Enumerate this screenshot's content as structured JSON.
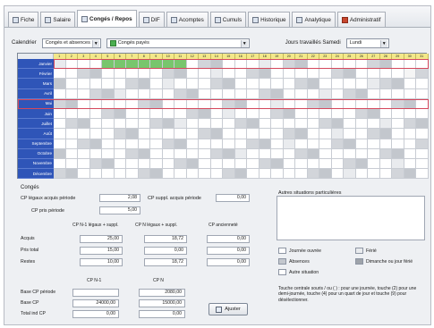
{
  "tabs": [
    {
      "label": "Fiche",
      "icon": "id-card-icon",
      "active": false
    },
    {
      "label": "Salaire",
      "icon": "wallet-icon",
      "active": false
    },
    {
      "label": "Congés / Repos",
      "icon": "calendar-icon",
      "active": true
    },
    {
      "label": "DIF",
      "icon": "graduation-icon",
      "active": false
    },
    {
      "label": "Acomptes",
      "icon": "money-icon",
      "active": false
    },
    {
      "label": "Cumuls",
      "icon": "sum-icon",
      "active": false
    },
    {
      "label": "Historique",
      "icon": "history-icon",
      "active": false
    },
    {
      "label": "Analytique",
      "icon": "chart-icon",
      "active": false
    },
    {
      "label": "Administratif",
      "icon": "folder-icon",
      "active": false
    }
  ],
  "filter": {
    "calendar_label": "Calendrier",
    "calendar_value": "Congés et absences",
    "type_value": "Congés payés",
    "hours_label": "Jours travaillés Samedi",
    "hours_value": "Lundi"
  },
  "calendar": {
    "days": [
      "1",
      "2",
      "3",
      "4",
      "5",
      "6",
      "7",
      "8",
      "9",
      "10",
      "11",
      "12",
      "13",
      "14",
      "15",
      "16",
      "17",
      "18",
      "19",
      "20",
      "21",
      "22",
      "23",
      "24",
      "25",
      "26",
      "27",
      "28",
      "29",
      "30",
      "31"
    ],
    "months": [
      "Janvier",
      "Février",
      "Mars",
      "Avril",
      "Mai",
      "Juin",
      "Juillet",
      "Août",
      "Septembre",
      "Octobre",
      "Novembre",
      "Décembre"
    ]
  },
  "conges": {
    "title": "Congés",
    "cp_acquis_label": "CP légaux acquis période",
    "cp_acquis_value": "2,08",
    "cp_suppl_label": "CP suppl. acquis période",
    "cp_suppl_value": "0,00",
    "cp_pris_label": "CP pris période",
    "cp_pris_value": "5,00",
    "columns": [
      "CP N-1 légaux + suppl.",
      "CP N légaux + suppl.",
      "CP ancienneté"
    ],
    "rows": [
      {
        "label": "Acquis",
        "values": [
          "25,00",
          "18,72",
          "0,00"
        ]
      },
      {
        "label": "Pris total",
        "values": [
          "15,00",
          "0,00",
          "0,00"
        ]
      },
      {
        "label": "Restes",
        "values": [
          "10,00",
          "18,72",
          "0,00"
        ]
      }
    ],
    "bottom_columns": [
      "CP N-1",
      "CP N"
    ],
    "bottom_rows": [
      {
        "label": "Base CP période",
        "values": [
          "",
          "2080,00"
        ]
      },
      {
        "label": "Base CP",
        "values": [
          "24000,00",
          "15000,00"
        ]
      },
      {
        "label": "Total ind CP",
        "values": [
          "0,00",
          "0,00"
        ]
      }
    ],
    "adjust_button": "Ajuster"
  },
  "other": {
    "title": "Autres situations particulières"
  },
  "legend": {
    "items": [
      {
        "label": "Journée ouvrée",
        "color": "#ffffff"
      },
      {
        "label": "Férié",
        "color": "#e9ebee"
      },
      {
        "label": "Absences",
        "color": "#c3c7cd"
      },
      {
        "label": "Dimanche ou jour férié",
        "color": "#9ea3aa"
      },
      {
        "label": "Autre situation",
        "color": "#ffffff"
      }
    ],
    "note": "Touche centrale souris / ou ( ) : pour une journée, touche (2) pour une demi-journée, touche (4) pour un quart de jour et touche (9) pour désélectionner."
  },
  "colors": {
    "month_bg": "#2f55b8",
    "daynum_bg": "#f3e88a",
    "vacation": "#78c66d",
    "outline": "#d5485d"
  }
}
